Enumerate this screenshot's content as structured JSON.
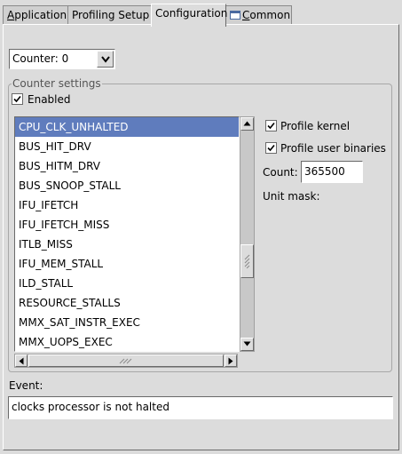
{
  "tabs": [
    {
      "label_mnemonic": "A",
      "label_rest": "pplication"
    },
    {
      "label": "Profiling Setup"
    },
    {
      "label": "Configuration"
    },
    {
      "label_mnemonic": "C",
      "label_rest": "ommon",
      "icon": "table-icon"
    }
  ],
  "active_tab": "Configuration",
  "counter_select": {
    "value": "Counter: 0",
    "icon": "chevron-down-icon"
  },
  "counter_settings": {
    "title": "Counter settings",
    "enabled": {
      "label": "Enabled",
      "checked": true
    },
    "events": [
      "CPU_CLK_UNHALTED",
      "BUS_HIT_DRV",
      "BUS_HITM_DRV",
      "BUS_SNOOP_STALL",
      "IFU_IFETCH",
      "IFU_IFETCH_MISS",
      "ITLB_MISS",
      "IFU_MEM_STALL",
      "ILD_STALL",
      "RESOURCE_STALLS",
      "MMX_SAT_INSTR_EXEC",
      "MMX_UOPS_EXEC"
    ],
    "selected_event": "CPU_CLK_UNHALTED",
    "profile_kernel": {
      "label": "Profile kernel",
      "checked": true
    },
    "profile_user": {
      "label": "Profile user binaries",
      "checked": true
    },
    "count_label": "Count:",
    "count_value": "365500",
    "unit_mask_label": "Unit mask:"
  },
  "event": {
    "label": "Event:",
    "description": "clocks processor is not halted"
  },
  "colors": {
    "selection": "#5f7cbd",
    "window_bg": "#dcdcdc"
  }
}
